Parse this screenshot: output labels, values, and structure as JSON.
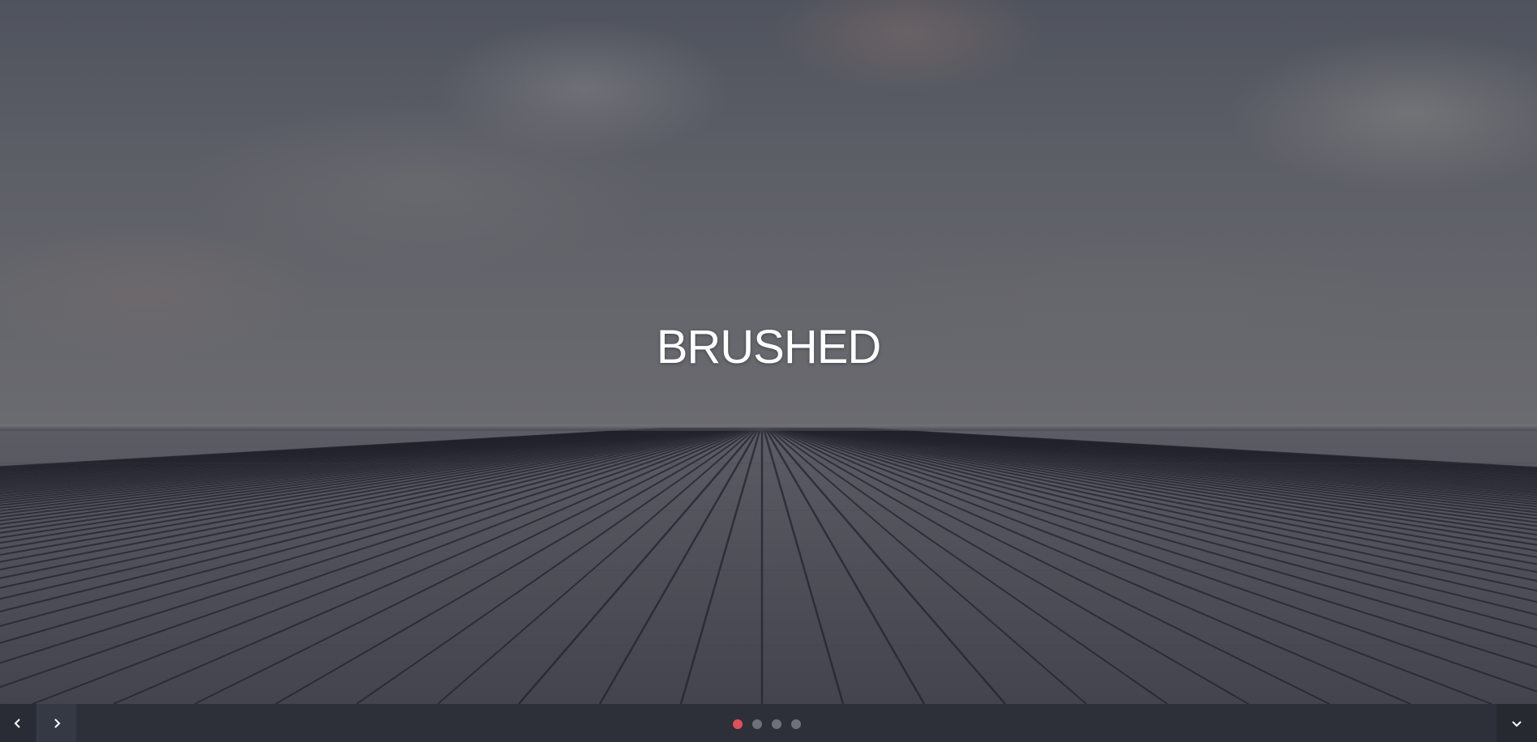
{
  "slide": {
    "title": "BRUSHED"
  },
  "navigation": {
    "prev_icon": "chevron-left-icon",
    "next_icon": "chevron-right-icon",
    "down_icon": "chevron-down-icon"
  },
  "pagination": {
    "total": 4,
    "active_index": 0,
    "active_color": "#e0505a",
    "inactive_color": "#6d717b"
  },
  "colors": {
    "bar_background": "#2d3039",
    "title_color": "#ffffff"
  }
}
